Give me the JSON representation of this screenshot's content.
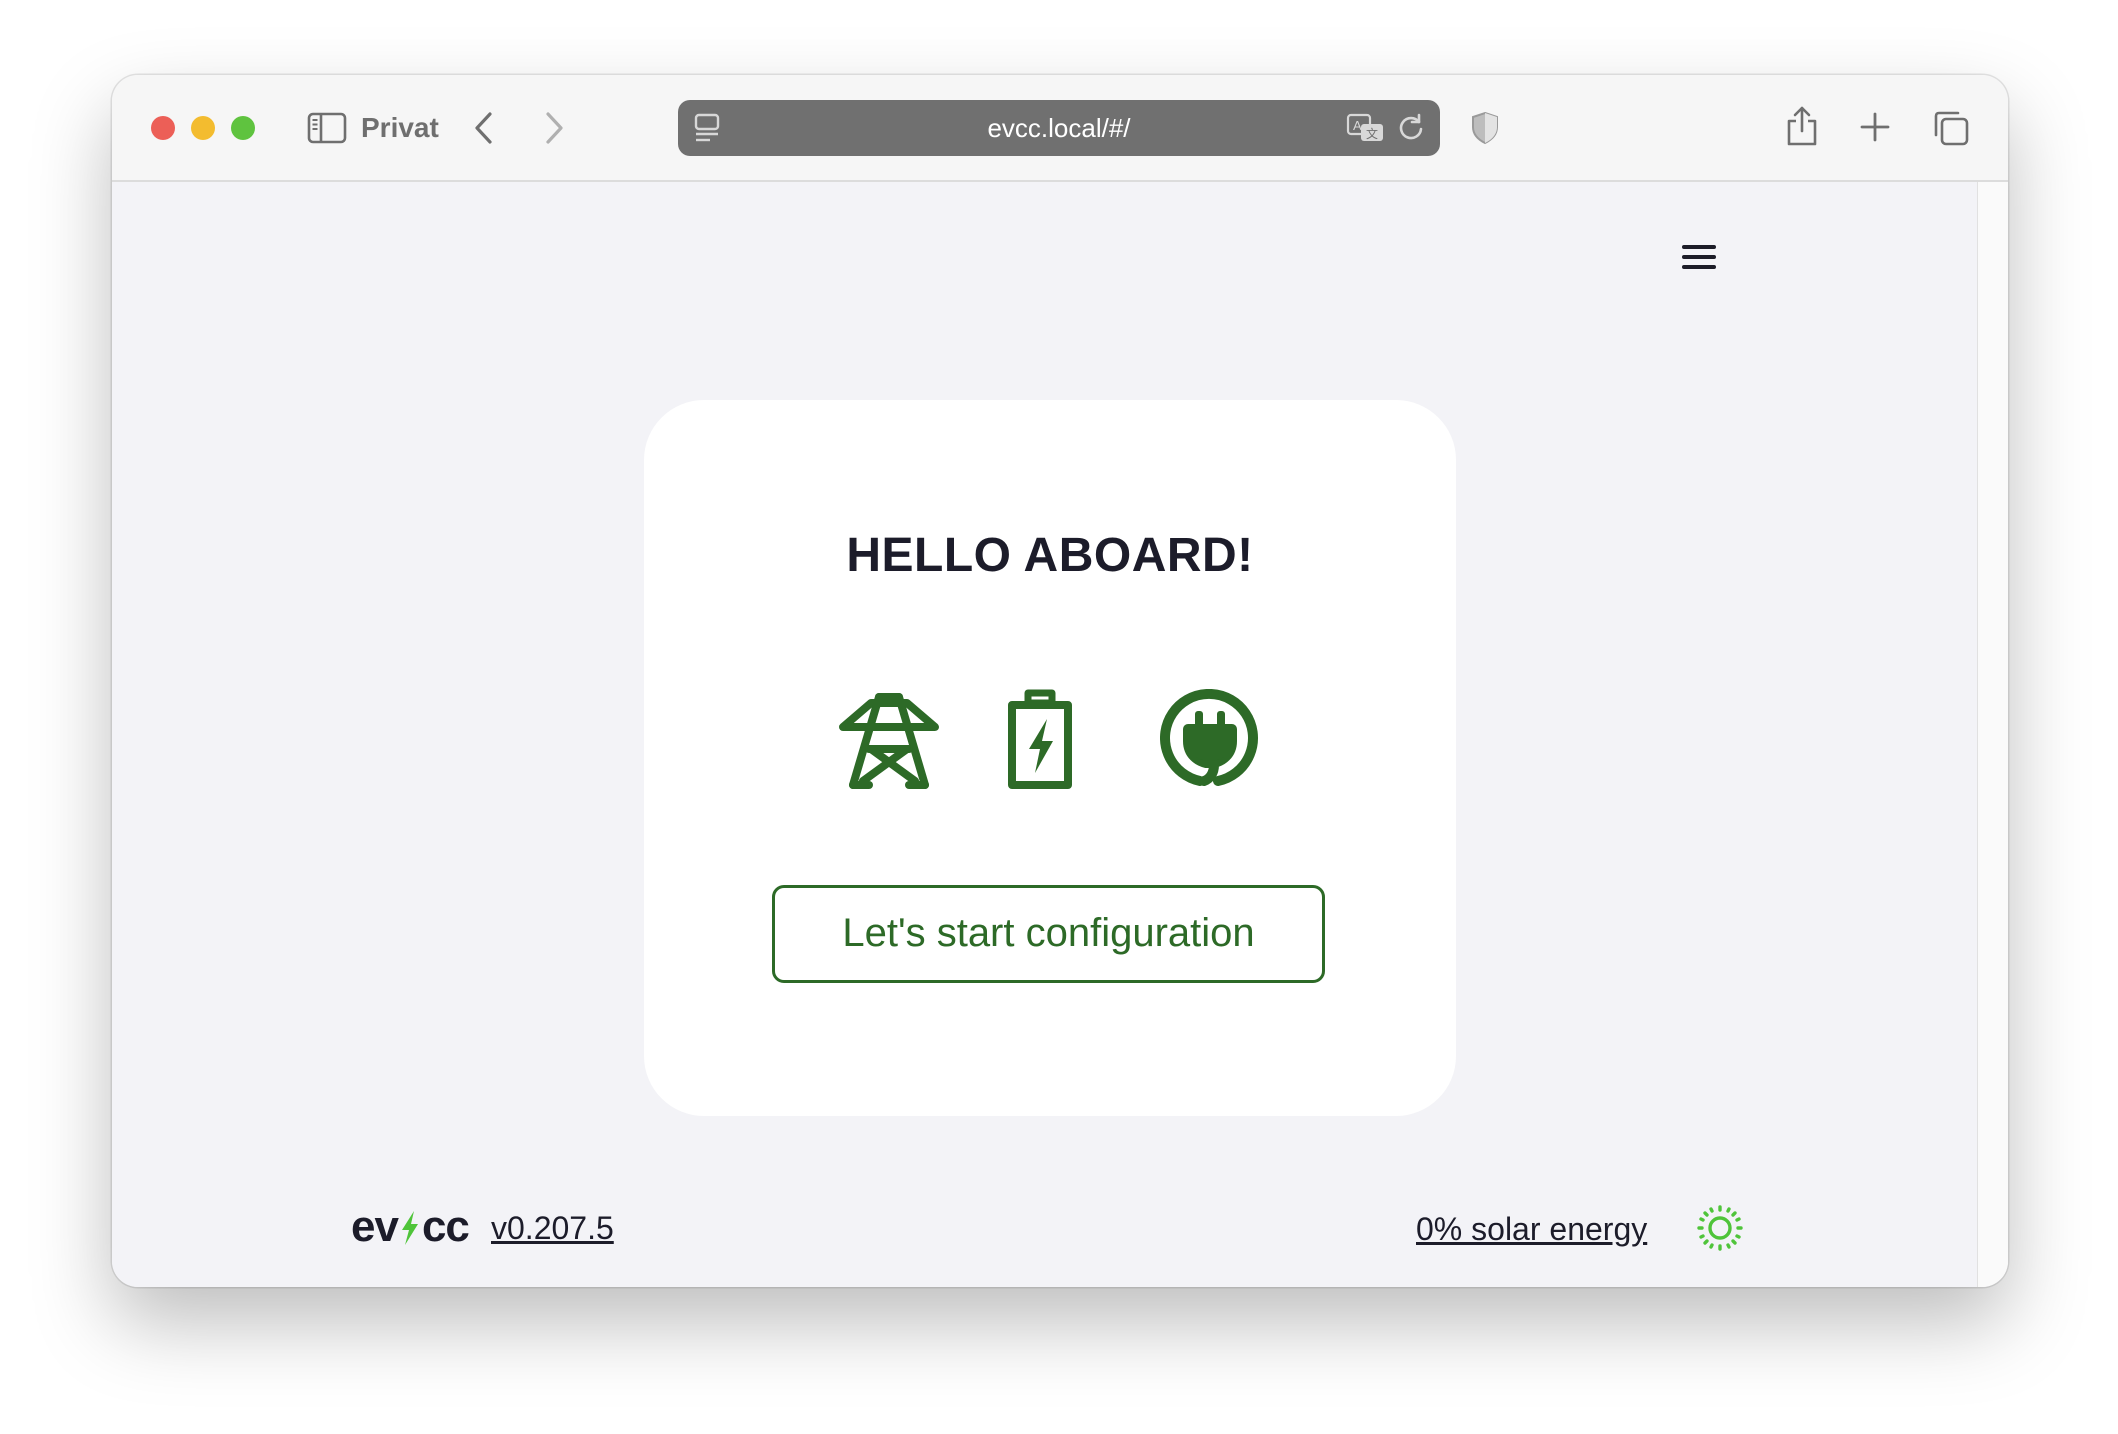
{
  "browser": {
    "profile_label": "Privat",
    "url": "evcc.local/#/"
  },
  "app": {
    "menu_icon": "hamburger-menu-icon"
  },
  "card": {
    "title": "HELLO ABOARD!",
    "icons": [
      "power-grid-tower-icon",
      "battery-charge-icon",
      "ev-plug-icon"
    ],
    "button_label": "Let's start configuration"
  },
  "footer": {
    "logo_left": "ev",
    "logo_right": "cc",
    "version": "v0.207.5",
    "solar_text": "0% solar energy",
    "solar_icon": "sun-icon"
  },
  "colors": {
    "brand_green": "#2d6a27",
    "logo_bolt_green": "#4fc43a",
    "text_dark": "#1c1c2a"
  }
}
